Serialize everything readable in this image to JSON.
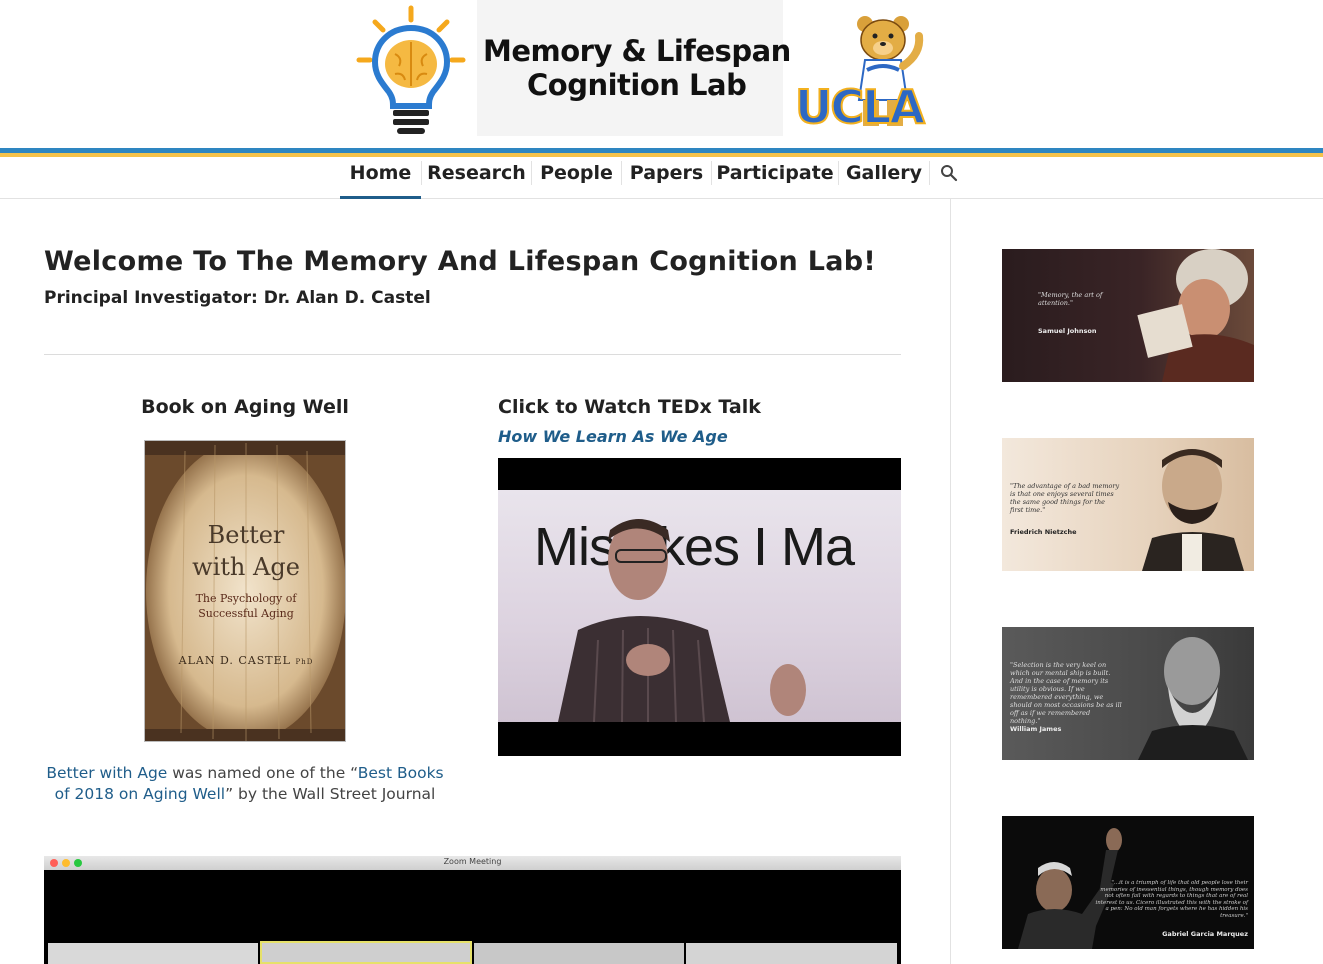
{
  "header": {
    "logo_line1": "Memory & Lifespan",
    "logo_line2": "Cognition Lab",
    "logo_ucla": "UCLA"
  },
  "nav": {
    "items": [
      {
        "label": "Home",
        "active": true
      },
      {
        "label": "Research"
      },
      {
        "label": "People"
      },
      {
        "label": "Papers"
      },
      {
        "label": "Participate"
      },
      {
        "label": "Gallery"
      }
    ],
    "search_icon": "search-icon"
  },
  "main": {
    "title": "Welcome To The Memory And Lifespan Cognition Lab!",
    "pi": "Principal Investigator: Dr. Alan D. Castel",
    "book": {
      "heading": "Book on Aging Well",
      "cover_title_1": "Better",
      "cover_title_2": "with Age",
      "cover_subtitle_1": "The Psychology of",
      "cover_subtitle_2": "Successful Aging",
      "cover_author": "ALAN D. CASTEL",
      "cover_author_suffix": "PhD",
      "caption_link1": "Better with Age",
      "caption_mid": " was named one of the “",
      "caption_link2": "Best Books of 2018 on Aging Well",
      "caption_end": "” by the Wall Street Journal"
    },
    "ted": {
      "heading": "Click to Watch TEDx Talk",
      "link": "How We Learn As We Age",
      "video_text": "Mistakes I Ma"
    },
    "zoom": {
      "title": "Zoom Meeting"
    }
  },
  "sidebar": {
    "quotes": [
      {
        "text": "\"Memory, the art of attention.\"",
        "author": "Samuel Johnson"
      },
      {
        "text": "\"The advantage of a bad memory is that one enjoys several times the same good things for the first time.\"",
        "author": "Friedrich Nietzche"
      },
      {
        "text": "\"Selection is the very keel on which our mental ship is built. And in the case of memory its utility is obvious. If we remembered everything, we should on most occasions be as ill off as if we remembered nothing.\"",
        "author": "William James"
      },
      {
        "text": "\"...it is a triumph of life that old people lose their memories of inessential things, though memory does not often fail with regards to things that are of real interest to us. Cicero illustrated this with the stroke of a pen: No old man forgets where he has hidden his treasure.\"",
        "author": "Gabriel Garcia Marquez"
      }
    ]
  },
  "colors": {
    "accent_blue": "#2e86c1",
    "accent_gold": "#f5c24a",
    "link": "#1f5d8a"
  }
}
